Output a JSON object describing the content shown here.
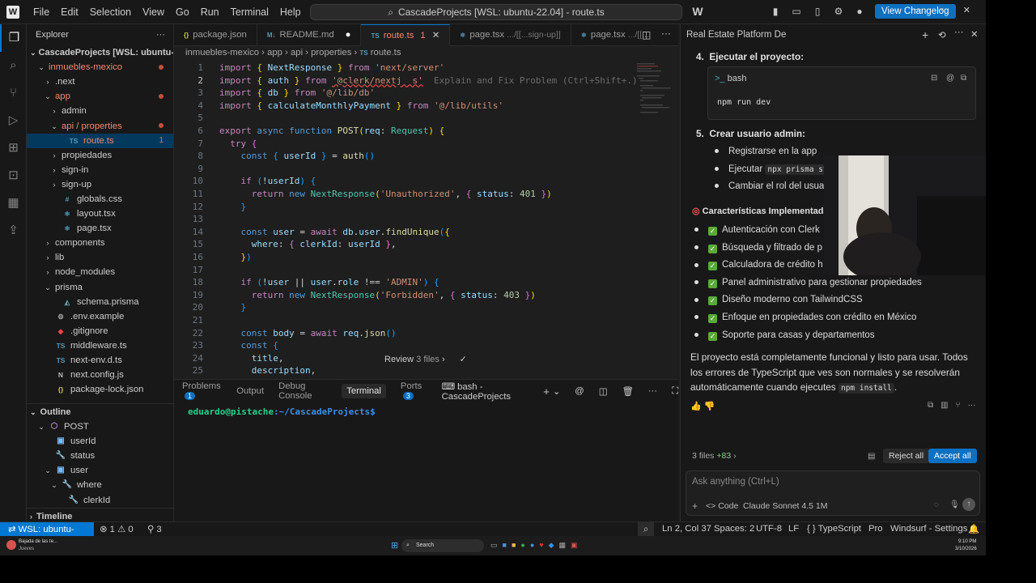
{
  "titlebar": {
    "menus": [
      "File",
      "Edit",
      "Selection",
      "View",
      "Go",
      "Run",
      "Terminal",
      "Help"
    ],
    "command_center": "CascadeProjects [WSL: ubuntu-22.04] - route.ts",
    "changelog_button": "View Changelog"
  },
  "sidebar": {
    "title": "Explorer",
    "root": "CascadeProjects [WSL: ubuntu-22...",
    "items": [
      {
        "label": "inmuebles-mexico",
        "depth": 1,
        "type": "folder-open",
        "color": "red",
        "dot": true
      },
      {
        "label": ".next",
        "depth": 2,
        "type": "folder"
      },
      {
        "label": "app",
        "depth": 2,
        "type": "folder-open",
        "color": "red",
        "dot": true
      },
      {
        "label": "admin",
        "depth": 3,
        "type": "folder"
      },
      {
        "label": "api / properties",
        "depth": 3,
        "type": "folder-open",
        "color": "red",
        "dot": true
      },
      {
        "label": "route.ts",
        "depth": 4,
        "type": "ts",
        "color": "red",
        "badge": "1",
        "selected": true
      },
      {
        "label": "propiedades",
        "depth": 3,
        "type": "folder"
      },
      {
        "label": "sign-in",
        "depth": 3,
        "type": "folder"
      },
      {
        "label": "sign-up",
        "depth": 3,
        "type": "folder"
      },
      {
        "label": "globals.css",
        "depth": 3,
        "type": "css"
      },
      {
        "label": "layout.tsx",
        "depth": 3,
        "type": "tsx"
      },
      {
        "label": "page.tsx",
        "depth": 3,
        "type": "tsx"
      },
      {
        "label": "components",
        "depth": 2,
        "type": "folder"
      },
      {
        "label": "lib",
        "depth": 2,
        "type": "folder"
      },
      {
        "label": "node_modules",
        "depth": 2,
        "type": "folder"
      },
      {
        "label": "prisma",
        "depth": 2,
        "type": "folder-open"
      },
      {
        "label": "schema.prisma",
        "depth": 3,
        "type": "prisma"
      },
      {
        "label": ".env.example",
        "depth": 2,
        "type": "env"
      },
      {
        "label": ".gitignore",
        "depth": 2,
        "type": "git"
      },
      {
        "label": "middleware.ts",
        "depth": 2,
        "type": "ts"
      },
      {
        "label": "next-env.d.ts",
        "depth": 2,
        "type": "ts"
      },
      {
        "label": "next.config.js",
        "depth": 2,
        "type": "next"
      },
      {
        "label": "package-lock.json",
        "depth": 2,
        "type": "json"
      }
    ],
    "outline_title": "Outline",
    "outline": [
      {
        "label": "POST",
        "depth": 1,
        "type": "func"
      },
      {
        "label": "userId",
        "depth": 2,
        "type": "var"
      },
      {
        "label": "status",
        "depth": 2,
        "type": "prop"
      },
      {
        "label": "user",
        "depth": 2,
        "type": "var"
      },
      {
        "label": "where",
        "depth": 3,
        "type": "prop"
      },
      {
        "label": "clerkId",
        "depth": 4,
        "type": "prop"
      }
    ],
    "timeline_title": "Timeline"
  },
  "tabs": [
    {
      "label": "package.json",
      "icon": "{}",
      "active": false
    },
    {
      "label": "README.md",
      "icon": "M↓",
      "active": false
    },
    {
      "label": "route.ts",
      "icon": "TS",
      "active": true,
      "badge": "1"
    },
    {
      "label": "page.tsx",
      "hint": ".../[[...sign-up]]",
      "icon": "⚛",
      "active": false
    },
    {
      "label": "page.tsx",
      "hint": ".../[[...",
      "icon": "⚛",
      "active": false
    }
  ],
  "breadcrumb": [
    "inmuebles-mexico",
    "app",
    "api",
    "properties",
    "route.ts"
  ],
  "code_hint": "Explain and Fix Problem (Ctrl+Shift+.)",
  "review": {
    "label": "Review",
    "files": "3 files"
  },
  "panel": {
    "tabs": [
      {
        "label": "Problems",
        "count": "1"
      },
      {
        "label": "Output"
      },
      {
        "label": "Debug Console"
      },
      {
        "label": "Terminal",
        "active": true
      },
      {
        "label": "Ports",
        "count": "3"
      }
    ],
    "shell": "bash - CascadeProjects",
    "prompt_user": "eduardo@pistache",
    "prompt_path": ":~/CascadeProjects$"
  },
  "chat": {
    "title": "Real Estate Platform De",
    "step4": {
      "num": "4.",
      "title": "Ejecutar el proyecto:",
      "lang": "bash",
      "code": "npm run dev"
    },
    "step5": {
      "num": "5.",
      "title": "Crear usuario admin:",
      "b1": "Registrarse en la app",
      "b2_pre": "Ejecutar",
      "b2_code": "npx prisma stu",
      "b3": "Cambiar el rol del usuar"
    },
    "features_title": "Características Implementadas",
    "features": [
      "Autenticación con Clerk",
      "Búsqueda y filtrado de p",
      "Calculadora de crédito h",
      "Panel administrativo para gestionar propiedades",
      "Diseño moderno con TailwindCSS",
      "Enfoque en propiedades con crédito en México",
      "Soporte para casas y departamentos"
    ],
    "summary_a": "El proyecto está completamente funcional y listo para usar. Todos los errores de TypeScript que ves son normales y se resolverán automáticamente cuando ejecutes",
    "summary_code": "npm install",
    "files_changed": "3 files",
    "lines_added": "+83",
    "reject_all": "Reject all",
    "accept_all": "Accept all",
    "input_placeholder": "Ask anything (Ctrl+L)",
    "mode": "Code",
    "model": "Claude Sonnet 4.5 1M"
  },
  "status": {
    "remote": "WSL: ubuntu-22.04",
    "errors": "1",
    "warnings": "0",
    "ports": "3",
    "position": "Ln 2, Col 37",
    "spaces": "Spaces: 2",
    "encoding": "UTF-8",
    "eol": "LF",
    "language": "TypeScript",
    "pro": "Pro",
    "settings": "Windsurf - Settings"
  },
  "taskbar": {
    "weather_line1": "Bajada de las te...",
    "weather_line2": "Jueves",
    "search": "Search",
    "time": "9:10 PM",
    "date": "3/10/2026"
  },
  "colors": {
    "accent": "#0078d4",
    "error": "#f48771",
    "check": "#5ca83a"
  }
}
